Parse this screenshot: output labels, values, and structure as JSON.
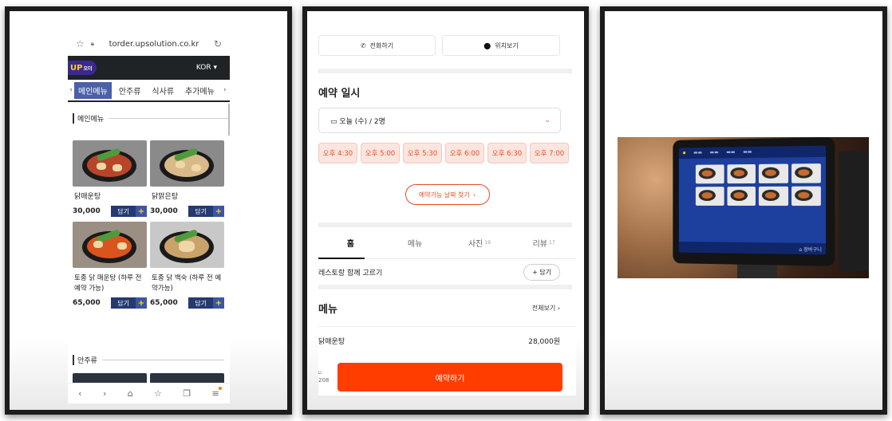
{
  "panel1": {
    "url": "torder.upsolution.co.kr",
    "logo": "UP",
    "logo_sub": "오더",
    "lang": "KOR ▾",
    "tabs": [
      "메인메뉴",
      "안주류",
      "식사류",
      "추가메뉴"
    ],
    "section1": "메인메뉴",
    "section2": "안주류",
    "add_label": "담기",
    "items": [
      {
        "name": "닭매운탕",
        "price": "30,000"
      },
      {
        "name": "닭맑은탕",
        "price": "30,000"
      },
      {
        "name": "토종 닭 매운탕 (하루 전 예약 가능)",
        "price": "65,000"
      },
      {
        "name": "토종 닭 백숙 (하루 전 예약가능)",
        "price": "65,000"
      }
    ]
  },
  "panel2": {
    "call": "전화하기",
    "location": "위치보기",
    "reservation_title": "예약 일시",
    "date": "오늘 (수) / 2명",
    "slots": [
      "오후 4:30",
      "오후 5:00",
      "오후 5:30",
      "오후 6:00",
      "오후 6:30",
      "오후 7:00"
    ],
    "find": "예약가능 날짜 찾기",
    "tabs": [
      {
        "label": "홈",
        "count": ""
      },
      {
        "label": "메뉴",
        "count": ""
      },
      {
        "label": "사진",
        "count": "19"
      },
      {
        "label": "리뷰",
        "count": "17"
      }
    ],
    "together": "레스토랑 함께 고르기",
    "together_btn": "+ 담기",
    "menu_title": "메뉴",
    "view_all": "전체보기",
    "menu_item": "닭매운탕",
    "menu_price": "28,000원",
    "bookmark_count": "208",
    "reserve": "예약하기"
  },
  "panel3": {
    "cart": "장바구니"
  }
}
